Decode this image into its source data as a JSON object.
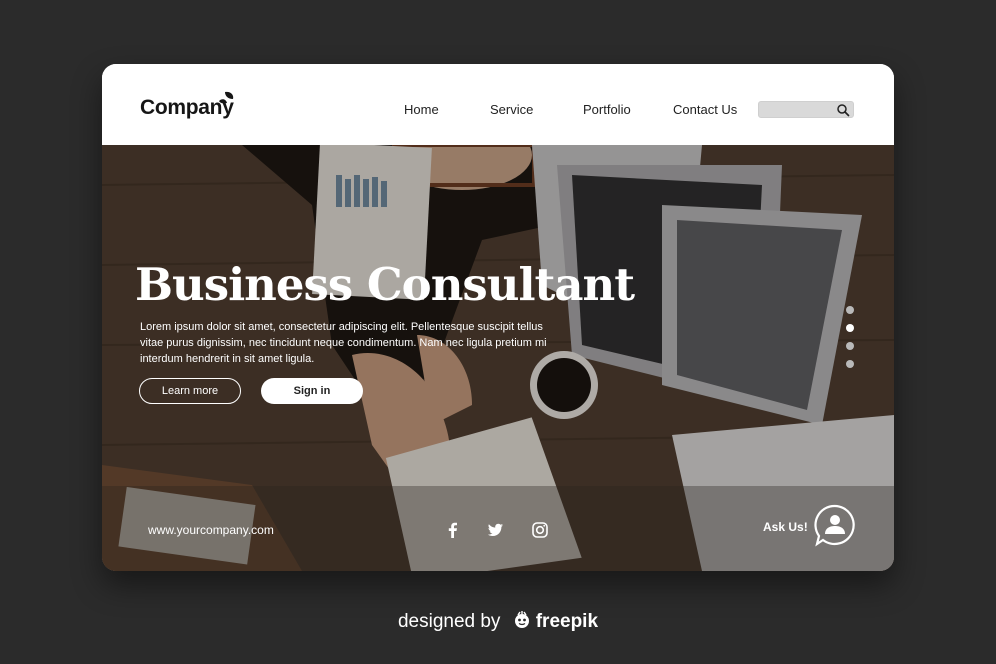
{
  "nav": {
    "logo_text": "Company",
    "menu": [
      {
        "label": "Home"
      },
      {
        "label": "Service"
      },
      {
        "label": "Portfolio"
      },
      {
        "label": "Contact Us"
      }
    ],
    "search": {
      "placeholder": "",
      "value": "",
      "icon": "search-icon"
    }
  },
  "hero": {
    "title": "Business Consultant",
    "body": "Lorem ipsum dolor sit amet, consectetur adipiscing elit. Pellentesque suscipit tellus vitae purus dignissim, nec tincidunt neque condimentum. Nam nec ligula pretium mi interdum hendrerit in sit amet ligula.",
    "learn_more_label": "Learn more",
    "sign_in_label": "Sign in",
    "slider_dots": 4,
    "active_dot": 2
  },
  "footer": {
    "website": "www.yourcompany.com",
    "social_icons": [
      "facebook-icon",
      "twitter-icon",
      "instagram-icon"
    ],
    "ask_label": "Ask Us!",
    "chat_icon": "chat-user-icon"
  },
  "credit": {
    "prefix": "designed by",
    "brand": "freepik"
  },
  "colors": {
    "background": "#2b2b2b",
    "card": "#ffffff",
    "accent_text": "#ffffff",
    "search_bg": "#d9d9d9"
  }
}
